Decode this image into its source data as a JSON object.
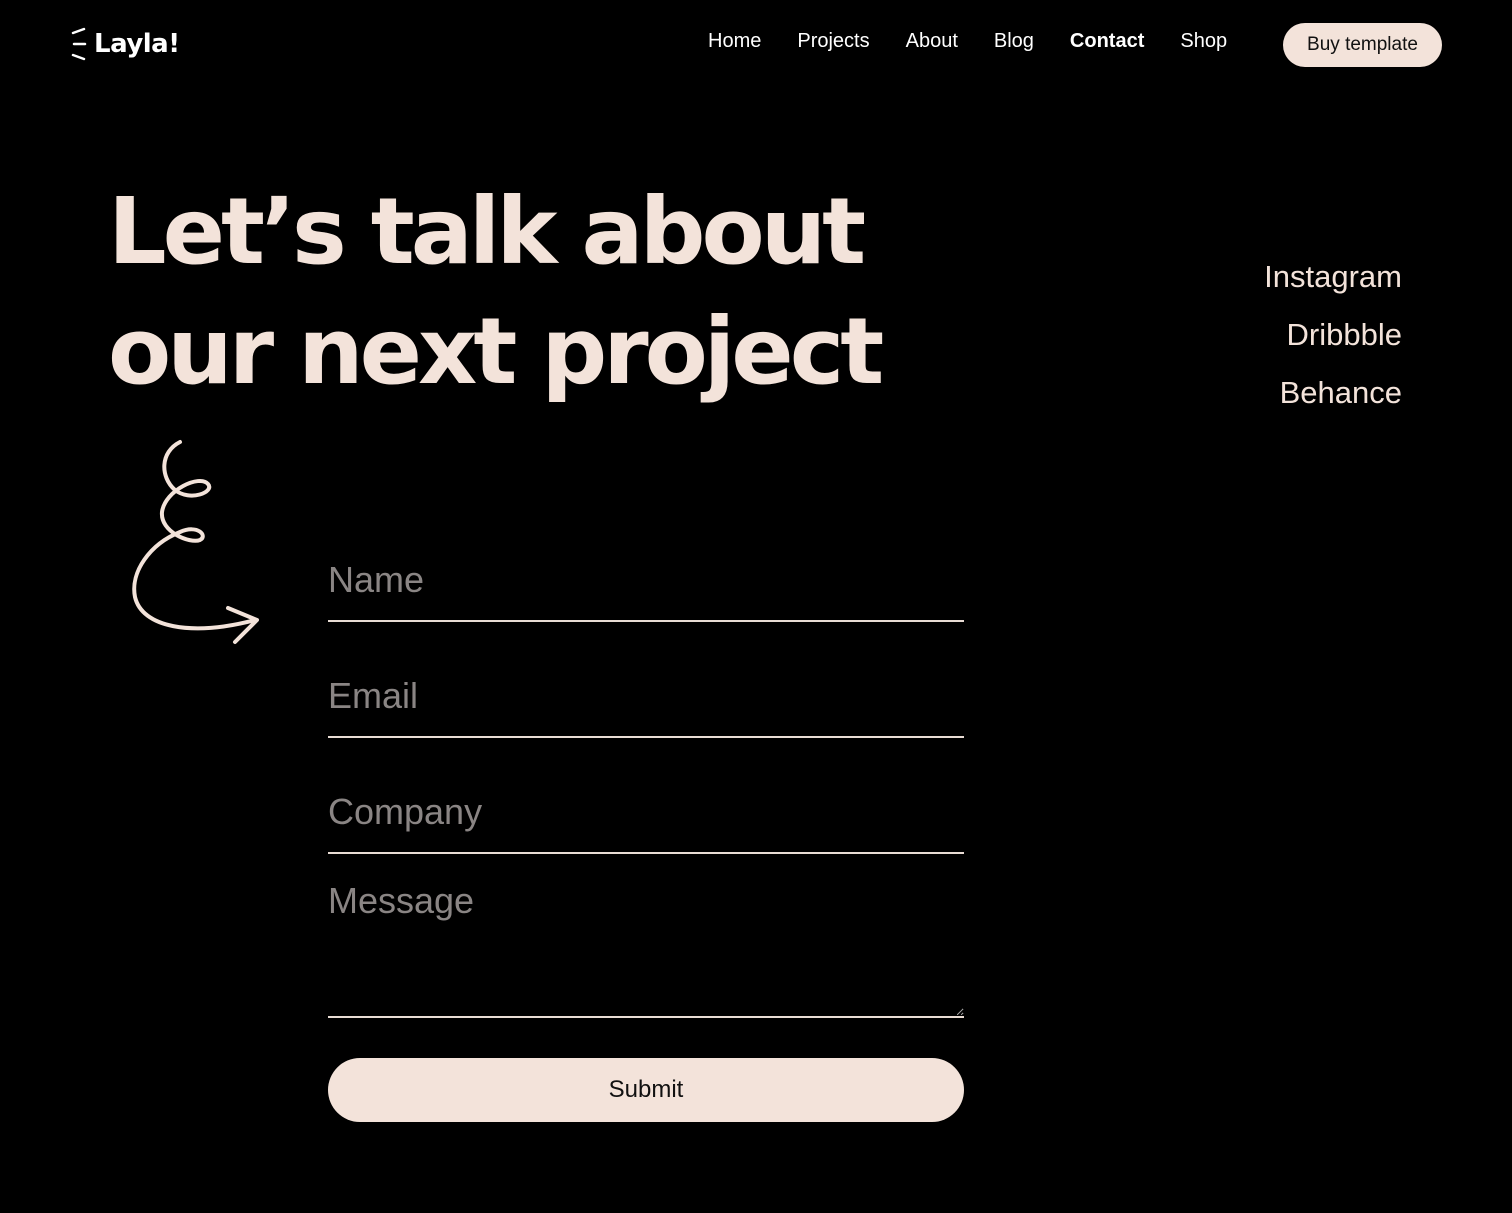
{
  "brand": {
    "name": "Layla!"
  },
  "nav": {
    "items": [
      {
        "label": "Home"
      },
      {
        "label": "Projects"
      },
      {
        "label": "About"
      },
      {
        "label": "Blog"
      },
      {
        "label": "Contact"
      },
      {
        "label": "Shop"
      }
    ],
    "active": "Contact",
    "buy_label": "Buy template"
  },
  "hero": {
    "line1": "Let’s talk about",
    "line2": "our next project"
  },
  "social": {
    "items": [
      {
        "label": "Instagram"
      },
      {
        "label": "Dribbble"
      },
      {
        "label": "Behance"
      }
    ]
  },
  "form": {
    "name_placeholder": "Name",
    "email_placeholder": "Email",
    "company_placeholder": "Company",
    "message_placeholder": "Message",
    "submit_label": "Submit"
  },
  "colors": {
    "background": "#000000",
    "accent": "#f3e3da",
    "placeholder": "#8a8584"
  },
  "icons": {
    "logo": "sparkle-lines-icon",
    "decoration": "squiggle-arrow-icon"
  }
}
